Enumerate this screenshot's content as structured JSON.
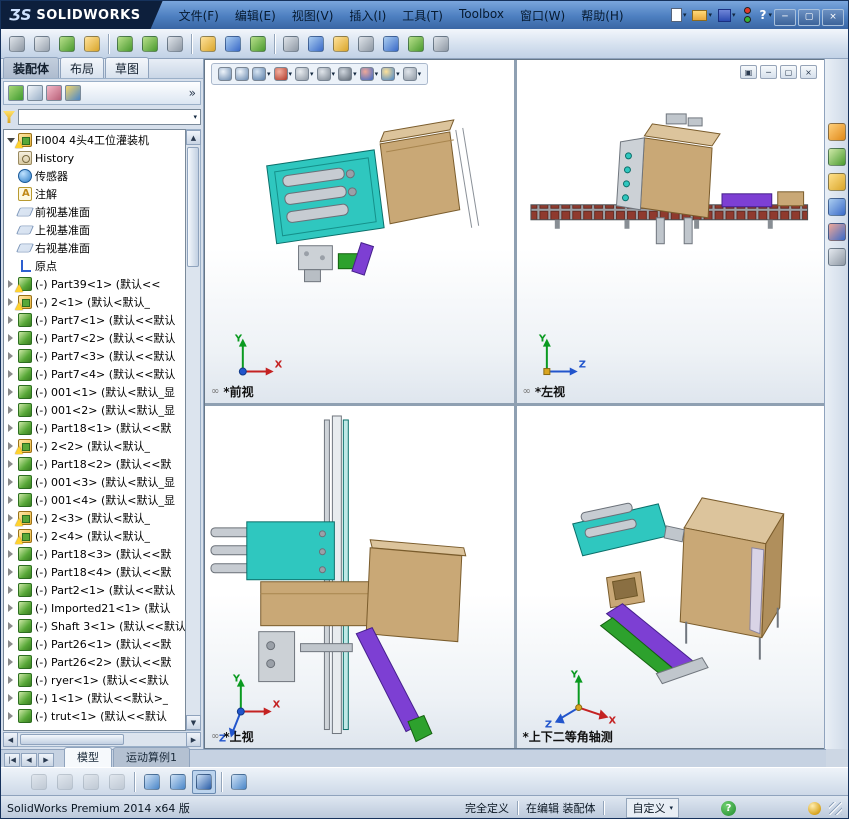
{
  "titlebar": {
    "brand_mark": "ƷS",
    "brand": "SOLIDWORKS",
    "menus": [
      {
        "name": "file",
        "label": "文件(F)"
      },
      {
        "name": "edit",
        "label": "编辑(E)"
      },
      {
        "name": "view",
        "label": "视图(V)"
      },
      {
        "name": "insert",
        "label": "插入(I)"
      },
      {
        "name": "tools",
        "label": "工具(T)"
      },
      {
        "name": "toolbox",
        "label": "Toolbox"
      },
      {
        "name": "window",
        "label": "窗口(W)"
      },
      {
        "name": "help",
        "label": "帮助(H)"
      }
    ],
    "help_label": "?",
    "window_buttons": [
      {
        "name": "minimize",
        "glyph": "─"
      },
      {
        "name": "maximize",
        "glyph": "▢"
      },
      {
        "name": "close",
        "glyph": "×"
      }
    ]
  },
  "toolbar": {
    "icons": [
      {
        "name": "insert-components",
        "c1": "#dfe4ea",
        "c2": "#8e98a4"
      },
      {
        "name": "mate",
        "c1": "#e8ecf0",
        "c2": "#98a2ae"
      },
      {
        "name": "linear-component-pattern",
        "c1": "#b8e08a",
        "c2": "#4a9a2f"
      },
      {
        "name": "smart-fasteners",
        "c1": "#ffe29a",
        "c2": "#d9a62c"
      },
      {
        "sep": true
      },
      {
        "name": "move-component",
        "c1": "#b8e08a",
        "c2": "#4a9a2f"
      },
      {
        "name": "rotate-component",
        "c1": "#b8e08a",
        "c2": "#4a9a2f"
      },
      {
        "name": "show-hidden-components",
        "c1": "#dfe4ea",
        "c2": "#8e98a4"
      },
      {
        "sep": true
      },
      {
        "name": "assembly-features",
        "c1": "#ffe29a",
        "c2": "#d9a62c"
      },
      {
        "name": "reference-geometry",
        "c1": "#aacdf0",
        "c2": "#3a6ac8"
      },
      {
        "name": "new-motion-study",
        "c1": "#b8e08a",
        "c2": "#4a9a2f"
      },
      {
        "sep": true
      },
      {
        "name": "bill-of-materials",
        "c1": "#dfe4ea",
        "c2": "#8e98a4"
      },
      {
        "name": "exploded-view",
        "c1": "#aacdf0",
        "c2": "#3a6ac8"
      },
      {
        "name": "interference-detection",
        "c1": "#ffe29a",
        "c2": "#d9a62c"
      },
      {
        "name": "measure",
        "c1": "#dfe4ea",
        "c2": "#8e98a4"
      },
      {
        "name": "mass-properties",
        "c1": "#aacdf0",
        "c2": "#3a6ac8"
      },
      {
        "name": "section-properties",
        "c1": "#b8e08a",
        "c2": "#4a9a2f"
      },
      {
        "name": "options",
        "c1": "#dfe4ea",
        "c2": "#8e98a4"
      }
    ]
  },
  "left_panel": {
    "tabs": [
      {
        "name": "assembly",
        "label": "装配体",
        "active": true
      },
      {
        "name": "layout",
        "label": "布局",
        "active": false
      },
      {
        "name": "sketch",
        "label": "草图",
        "active": false
      }
    ],
    "manager_tabs": [
      {
        "name": "featuremanager",
        "c1": "#a8d878",
        "c2": "#3f9b2f"
      },
      {
        "name": "propertymanager",
        "c1": "#f2f6fa",
        "c2": "#9ab0c8"
      },
      {
        "name": "configurationmanager",
        "c1": "#f4b8c8",
        "c2": "#b86078"
      },
      {
        "name": "displaymanager",
        "c1": "#f5d76e",
        "c2": "#4a86c8"
      }
    ],
    "tree": [
      {
        "label": "FI004 4头4工位灌装机",
        "icon": "assembly",
        "warn": true,
        "arrow": "e"
      },
      {
        "label": "History",
        "icon": "history",
        "arrow": null
      },
      {
        "label": "传感器",
        "icon": "sensor",
        "arrow": null
      },
      {
        "label": "注解",
        "icon": "annotation",
        "arrow": null
      },
      {
        "label": "前视基准面",
        "icon": "plane",
        "arrow": null
      },
      {
        "label": "上视基准面",
        "icon": "plane",
        "arrow": null
      },
      {
        "label": "右视基准面",
        "icon": "plane",
        "arrow": null
      },
      {
        "label": "原点",
        "icon": "origin",
        "arrow": null
      },
      {
        "label": "(-) Part39<1> (默认<<",
        "icon": "part",
        "warn": true,
        "arrow": "c"
      },
      {
        "label": "(-) 2<1> (默认<默认_",
        "icon": "assembly",
        "warn": true,
        "arrow": "c"
      },
      {
        "label": "(-) Part7<1> (默认<<默认",
        "icon": "part",
        "arrow": "c"
      },
      {
        "label": "(-) Part7<2> (默认<<默认",
        "icon": "part",
        "arrow": "c"
      },
      {
        "label": "(-) Part7<3> (默认<<默认",
        "icon": "part",
        "arrow": "c"
      },
      {
        "label": "(-) Part7<4> (默认<<默认",
        "icon": "part",
        "arrow": "c"
      },
      {
        "label": "(-) 001<1> (默认<默认_显",
        "icon": "part",
        "arrow": "c"
      },
      {
        "label": "(-) 001<2> (默认<默认_显",
        "icon": "part",
        "arrow": "c"
      },
      {
        "label": "(-) Part18<1> (默认<<默",
        "icon": "part",
        "arrow": "c"
      },
      {
        "label": "(-) 2<2> (默认<默认_",
        "icon": "assembly",
        "warn": true,
        "arrow": "c"
      },
      {
        "label": "(-) Part18<2> (默认<<默",
        "icon": "part",
        "arrow": "c"
      },
      {
        "label": "(-) 001<3> (默认<默认_显",
        "icon": "part",
        "arrow": "c"
      },
      {
        "label": "(-) 001<4> (默认<默认_显",
        "icon": "part",
        "arrow": "c"
      },
      {
        "label": "(-) 2<3> (默认<默认_",
        "icon": "assembly",
        "warn": true,
        "arrow": "c"
      },
      {
        "label": "(-) 2<4> (默认<默认_",
        "icon": "assembly",
        "warn": true,
        "arrow": "c"
      },
      {
        "label": "(-) Part18<3> (默认<<默",
        "icon": "part",
        "arrow": "c"
      },
      {
        "label": "(-) Part18<4> (默认<<默",
        "icon": "part",
        "arrow": "c"
      },
      {
        "label": "(-) Part2<1> (默认<<默认",
        "icon": "part",
        "arrow": "c"
      },
      {
        "label": "(-) Imported21<1> (默认",
        "icon": "part",
        "arrow": "c"
      },
      {
        "label": "(-) Shaft 3<1> (默认<<默认",
        "icon": "part",
        "arrow": "c"
      },
      {
        "label": "(-) Part26<1> (默认<<默",
        "icon": "part",
        "arrow": "c"
      },
      {
        "label": "(-) Part26<2> (默认<<默",
        "icon": "part",
        "arrow": "c"
      },
      {
        "label": "(-) ryer<1> (默认<<默认",
        "icon": "part",
        "arrow": "c"
      },
      {
        "label": "(-) 1<1> (默认<<默认>_",
        "icon": "part",
        "arrow": "c"
      },
      {
        "label": "(-) trut<1> (默认<<默认",
        "icon": "part",
        "arrow": "c"
      }
    ]
  },
  "viewport_toolbar": {
    "icons": [
      {
        "name": "zoom-to-fit",
        "c1": "#eef4fa",
        "c2": "#6a8ab0",
        "dd": false
      },
      {
        "name": "zoom-to-area",
        "c1": "#eef4fa",
        "c2": "#6a8ab0",
        "dd": false
      },
      {
        "name": "previous-view",
        "c1": "#d6e4f2",
        "c2": "#5a7ea8",
        "dd": true
      },
      {
        "name": "section-view",
        "c1": "#f4b0a0",
        "c2": "#b03a2a",
        "dd": true
      },
      {
        "name": "view-orientation",
        "c1": "#e8ecf0",
        "c2": "#8e98a4",
        "dd": true
      },
      {
        "name": "display-style",
        "c1": "#dfe4ea",
        "c2": "#7e8894",
        "dd": true
      },
      {
        "name": "hide-show-items",
        "c1": "#cfd6de",
        "c2": "#5e6874",
        "dd": true
      },
      {
        "name": "edit-appearance",
        "c1": "#f0a898",
        "c2": "#3a6ac8",
        "dd": true
      },
      {
        "name": "apply-scene",
        "c1": "#ffe29a",
        "c2": "#4a86c8",
        "dd": true
      },
      {
        "name": "view-settings",
        "c1": "#dfe4ea",
        "c2": "#8e98a4",
        "dd": true
      }
    ]
  },
  "viewport_window_buttons": [
    {
      "name": "restore",
      "glyph": "▣"
    },
    {
      "name": "minimize",
      "glyph": "─"
    },
    {
      "name": "maximize",
      "glyph": "▢"
    },
    {
      "name": "close",
      "glyph": "×"
    }
  ],
  "viewports": [
    {
      "name": "front",
      "label": "*前视"
    },
    {
      "name": "left",
      "label": "*左视"
    },
    {
      "name": "top",
      "label": "*上视"
    },
    {
      "name": "isometric",
      "label": "*上下二等角轴测"
    }
  ],
  "task_pane": {
    "icons": [
      {
        "name": "solidworks-resources",
        "c1": "#ffcf7a",
        "c2": "#e08a1a"
      },
      {
        "name": "design-library",
        "c1": "#cfe9a8",
        "c2": "#4a9a2f"
      },
      {
        "name": "file-explorer",
        "c1": "#ffe08a",
        "c2": "#d9a62c"
      },
      {
        "name": "view-palette",
        "c1": "#aacdf0",
        "c2": "#3a6ac8"
      },
      {
        "name": "appearances-scenes",
        "c1": "#f0a898",
        "c2": "#3a6ac8"
      },
      {
        "name": "custom-properties",
        "c1": "#e4e9ef",
        "c2": "#8e98a4"
      }
    ]
  },
  "bottom_tabs": {
    "nav": [
      {
        "name": "first",
        "glyph": "|◀"
      },
      {
        "name": "previous",
        "glyph": "◀"
      },
      {
        "name": "next",
        "glyph": "▶"
      }
    ],
    "tabs": [
      {
        "name": "model",
        "label": "模型",
        "active": true
      },
      {
        "name": "motion-study-1",
        "label": "运动算例1",
        "active": false
      }
    ]
  },
  "bottom_toolbar": {
    "icons": [
      {
        "name": "previous-view",
        "c1": "#d8dde2",
        "c2": "#9aa2aa",
        "disabled": true
      },
      {
        "name": "rotate-view",
        "c1": "#d8dde2",
        "c2": "#9aa2aa",
        "disabled": true
      },
      {
        "name": "pan-view",
        "c1": "#d8dde2",
        "c2": "#9aa2aa",
        "disabled": true
      },
      {
        "name": "zoom-view",
        "c1": "#d8dde2",
        "c2": "#9aa2aa",
        "disabled": true
      },
      {
        "sep": true
      },
      {
        "name": "single-viewport",
        "c1": "#cfe2f6",
        "c2": "#4a86c8"
      },
      {
        "name": "two-viewport",
        "c1": "#cfe2f6",
        "c2": "#4a86c8"
      },
      {
        "name": "four-viewport",
        "c1": "#cfe2f6",
        "c2": "#2c5fa8",
        "active": true
      },
      {
        "sep": true
      },
      {
        "name": "viewport-grid",
        "c1": "#cfe2f6",
        "c2": "#4a86c8"
      }
    ]
  },
  "statusbar": {
    "app": "SolidWorks Premium 2014 x64 版",
    "defined": "完全定义",
    "editing": "在编辑 装配体",
    "custom": "自定义"
  },
  "ui": {
    "chevron": "»",
    "dropdown": "▼",
    "dd_small": "▾",
    "link_icon": "∞",
    "up": "▲",
    "down": "▼",
    "left": "◀",
    "right": "▶",
    "axis_x": "X",
    "axis_y": "Y",
    "axis_z": "Z"
  }
}
